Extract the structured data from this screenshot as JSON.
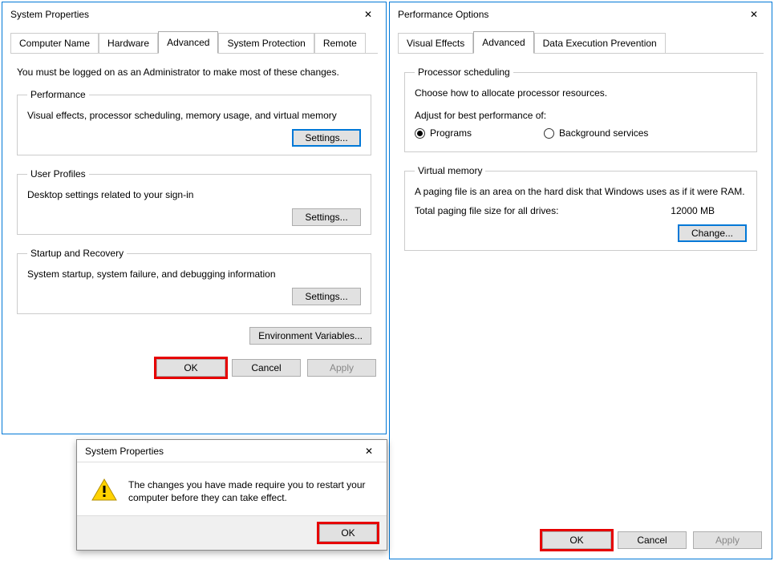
{
  "sysprops": {
    "title": "System Properties",
    "tabs": {
      "computer_name": "Computer Name",
      "hardware": "Hardware",
      "advanced": "Advanced",
      "system_protection": "System Protection",
      "remote": "Remote"
    },
    "hint": "You must be logged on as an Administrator to make most of these changes.",
    "performance": {
      "legend": "Performance",
      "desc": "Visual effects, processor scheduling, memory usage, and virtual memory",
      "settings_btn": "Settings..."
    },
    "user_profiles": {
      "legend": "User Profiles",
      "desc": "Desktop settings related to your sign-in",
      "settings_btn": "Settings..."
    },
    "startup": {
      "legend": "Startup and Recovery",
      "desc": "System startup, system failure, and debugging information",
      "settings_btn": "Settings..."
    },
    "env_btn": "Environment Variables...",
    "footer": {
      "ok": "OK",
      "cancel": "Cancel",
      "apply": "Apply"
    }
  },
  "perfopts": {
    "title": "Performance Options",
    "tabs": {
      "visual": "Visual Effects",
      "advanced": "Advanced",
      "dep": "Data Execution Prevention"
    },
    "processor": {
      "legend": "Processor scheduling",
      "desc": "Choose how to allocate processor resources.",
      "adjust_label": "Adjust for best performance of:",
      "programs": "Programs",
      "background": "Background services"
    },
    "vmem": {
      "legend": "Virtual memory",
      "desc": "A paging file is an area on the hard disk that Windows uses as if it were RAM.",
      "total_label": "Total paging file size for all drives:",
      "total_value": "12000 MB",
      "change_btn": "Change..."
    },
    "footer": {
      "ok": "OK",
      "cancel": "Cancel",
      "apply": "Apply"
    }
  },
  "msgbox": {
    "title": "System Properties",
    "text": "The changes you have made require you to restart your computer before they can take effect.",
    "ok": "OK"
  }
}
